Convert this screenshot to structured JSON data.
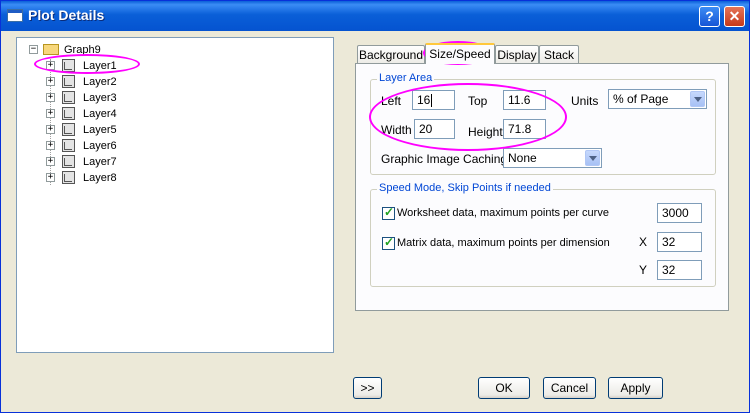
{
  "window": {
    "title": "Plot Details",
    "help_label": "?",
    "close_label": "✕"
  },
  "tree": {
    "root": "Graph9",
    "layers": [
      "Layer1",
      "Layer2",
      "Layer3",
      "Layer4",
      "Layer5",
      "Layer6",
      "Layer7",
      "Layer8"
    ],
    "selected": "Layer1"
  },
  "tabs": [
    "Background",
    "Size/Speed",
    "Display",
    "Stack"
  ],
  "active_tab": "Size/Speed",
  "layer_area": {
    "title": "Layer Area",
    "left_label": "Left",
    "left_value": "16",
    "top_label": "Top",
    "top_value": "11.6",
    "units_label": "Units",
    "units_value": "% of Page",
    "width_label": "Width",
    "width_value": "20",
    "height_label": "Height",
    "height_value": "71.8",
    "caching_label": "Graphic Image Caching",
    "caching_value": "None"
  },
  "speed_mode": {
    "title": "Speed Mode, Skip Points if needed",
    "worksheet_label": "Worksheet data, maximum points per curve",
    "worksheet_checked": true,
    "worksheet_value": "3000",
    "matrix_label": "Matrix data, maximum points per dimension",
    "matrix_checked": true,
    "x_label": "X",
    "x_value": "32",
    "y_label": "Y",
    "y_value": "32"
  },
  "buttons": {
    "expand": ">>",
    "ok": "OK",
    "cancel": "Cancel",
    "apply": "Apply"
  },
  "colors": {
    "titlebar": "#0a5fd8",
    "highlight": "#ff00ff",
    "group_title": "#0046d5"
  }
}
